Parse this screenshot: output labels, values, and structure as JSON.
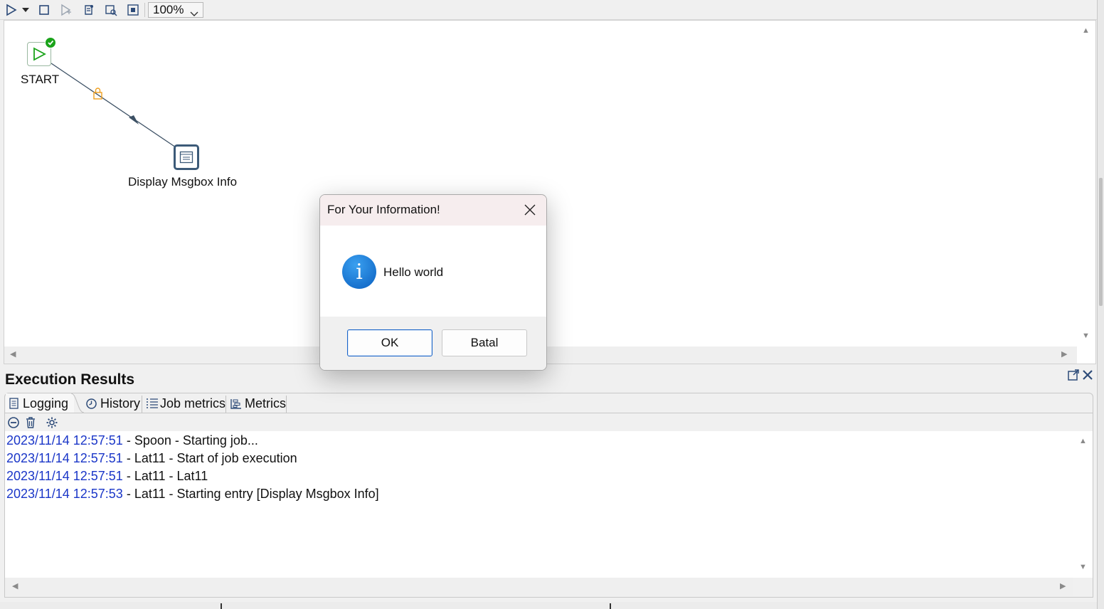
{
  "toolbar": {
    "zoom_value": "100%",
    "icons": [
      "run-icon",
      "run-dropdown-icon",
      "stop-icon",
      "preview-icon",
      "check-icon",
      "analyze-icon",
      "impact-icon"
    ]
  },
  "canvas": {
    "nodes": [
      {
        "name": "start",
        "label": "START",
        "icon": "start-icon",
        "status": "success"
      },
      {
        "name": "display-msgbox",
        "label": "Display Msgbox Info",
        "icon": "msgbox-icon"
      }
    ],
    "hop": {
      "from": "START",
      "to": "Display Msgbox Info",
      "locked": true
    }
  },
  "dialog": {
    "title": "For Your Information!",
    "icon": "info-icon",
    "message": "Hello world",
    "ok_label": "OK",
    "cancel_label": "Batal"
  },
  "execution_results": {
    "title": "Execution Results",
    "tabs": [
      {
        "label": "Logging",
        "icon": "logging-icon",
        "active": true
      },
      {
        "label": "History",
        "icon": "history-icon"
      },
      {
        "label": "Job metrics",
        "icon": "job-metrics-icon"
      },
      {
        "label": "Metrics",
        "icon": "metrics-icon"
      }
    ],
    "log_lines": [
      {
        "timestamp": "2023/11/14 12:57:51",
        "text": " - Spoon - Starting job..."
      },
      {
        "timestamp": "2023/11/14 12:57:51",
        "text": " - Lat11 - Start of job execution"
      },
      {
        "timestamp": "2023/11/14 12:57:51",
        "text": " - Lat11 - Lat11"
      },
      {
        "timestamp": "2023/11/14 12:57:53",
        "text": " - Lat11 - Starting entry [Display Msgbox Info]"
      }
    ]
  },
  "colors": {
    "timestamp": "#1a36c8",
    "start_green": "#1aa31a",
    "hop_line": "#3c5064",
    "lock_orange": "#f0a020",
    "dialog_title_bg": "#f6edee",
    "info_blue": "#0a6fd8"
  }
}
